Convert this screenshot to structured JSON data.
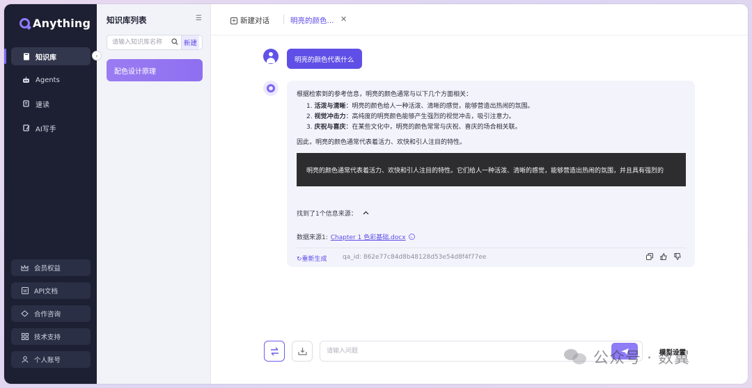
{
  "app": {
    "name": "Anything"
  },
  "nav": {
    "items": [
      {
        "label": "知识库",
        "icon": "book-icon"
      },
      {
        "label": "Agents",
        "icon": "robot-icon"
      },
      {
        "label": "速读",
        "icon": "speed-read-icon"
      },
      {
        "label": "AI写手",
        "icon": "pen-icon"
      }
    ],
    "bottom": [
      {
        "label": "会员权益",
        "icon": "crown-icon"
      },
      {
        "label": "API文档",
        "icon": "doc-icon"
      },
      {
        "label": "合作咨询",
        "icon": "handshake-icon"
      },
      {
        "label": "技术支持",
        "icon": "grid-icon"
      },
      {
        "label": "个人账号",
        "icon": "user-icon"
      }
    ]
  },
  "kb_panel": {
    "title": "知识库列表",
    "search_placeholder": "请输入知识库名称",
    "new_label": "新建",
    "items": [
      {
        "label": "配色设计原理"
      }
    ]
  },
  "tabs": {
    "new_chat": "新建对话",
    "active": "明亮的颜色..."
  },
  "chat": {
    "question": "明亮的颜色代表什么",
    "answer": {
      "intro": "根据检索到的参考信息，明亮的颜色通常与以下几个方面相关：",
      "points": [
        {
          "num": "1.",
          "bold": "活泼与清晰",
          "text": "：明亮的颜色给人一种活泼、清晰的感觉，能够营造出热闹的氛围。"
        },
        {
          "num": "2.",
          "bold": "视觉冲击力",
          "text": "：高纯度的明亮颜色能够产生强烈的视觉冲击，吸引注意力。"
        },
        {
          "num": "3.",
          "bold": "庆祝与喜庆",
          "text": "：在某些文化中，明亮的颜色常常与庆祝、喜庆的场合相关联。"
        }
      ],
      "summary": "因此，明亮的颜色通常代表着活力、欢快和引人注目的特性。",
      "code": "明亮的颜色通常代表着活力、欢快和引人注目的特性。它们给人一种活泼、清晰的感觉，能够营造出热闹的氛围，并且具有强烈的",
      "sources_found": "找到了1个信息来源：",
      "source_prefix": "数据来源1:",
      "source_link": "Chapter 1 色彩基础.docx",
      "regenerate": "重新生成",
      "qa_id_label": "qa_id:",
      "qa_id": "862e77c84d8b48128d53e54d8f4f77ee"
    }
  },
  "composer": {
    "placeholder": "请输入问题",
    "settings_label": "模型设置"
  },
  "watermark": {
    "text": "公众号 · 数翼"
  },
  "colors": {
    "accent": "#5f4fe6",
    "nav_bg": "#1d2032"
  }
}
